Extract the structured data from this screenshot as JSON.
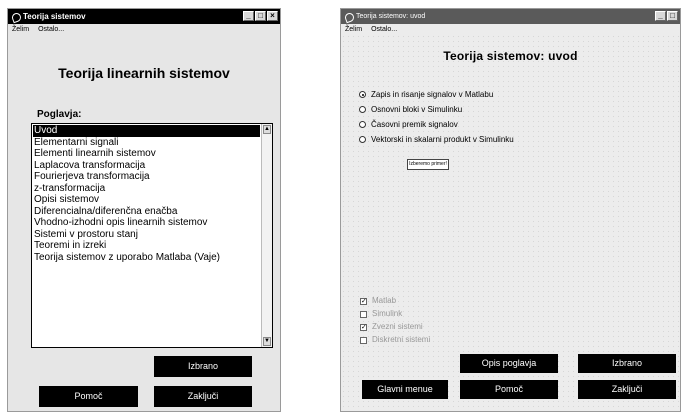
{
  "left_window": {
    "title": "Teorija sistemov",
    "menu": [
      "Želim",
      "Ostalo..."
    ],
    "heading": "Teorija linearnih sistemov",
    "list_label": "Poglavja:",
    "list_items": [
      "Uvod",
      "Elementarni signali",
      "Elementi linearnih sistemov",
      "Laplacova transformacija",
      "Fourierjeva transformacija",
      "z-transformacija",
      "Opisi sistemov",
      "Diferencialna/diferenčna enačba",
      "Vhodno-izhodni opis linearnih sistemov",
      "Sistemi v prostoru stanj",
      "Teoremi in izreki",
      "Teorija sistemov z uporabo Matlaba (Vaje)"
    ],
    "selected_index": 0,
    "buttons": {
      "izbrano": "Izbrano",
      "pomoc": "Pomoč",
      "zakljuci": "Zaključi"
    }
  },
  "right_window": {
    "title": "Teorija sistemov: uvod",
    "menu": [
      "Želim",
      "Ostalo..."
    ],
    "heading": "Teorija sistemov: uvod",
    "radio_options": [
      "Zapis in risanje signalov v Matlabu",
      "Osnovni bloki v Simulinku",
      "Časovni premik signalov",
      "Vektorski in skalarni produkt v Simulinku"
    ],
    "selected_radio": 0,
    "select_button": "Izberemo primer!",
    "checkboxes": [
      {
        "label": "Matlab",
        "checked": true
      },
      {
        "label": "Simulink",
        "checked": false
      },
      {
        "label": "Zvezni sistemi",
        "checked": true
      },
      {
        "label": "Diskretni sistemi",
        "checked": false
      }
    ],
    "buttons": {
      "opis_poglavja": "Opis poglavja",
      "izbrano": "Izbrano",
      "glavni_menue": "Glavni menue",
      "pomoc": "Pomoč",
      "zakljuci": "Zaključi"
    }
  }
}
